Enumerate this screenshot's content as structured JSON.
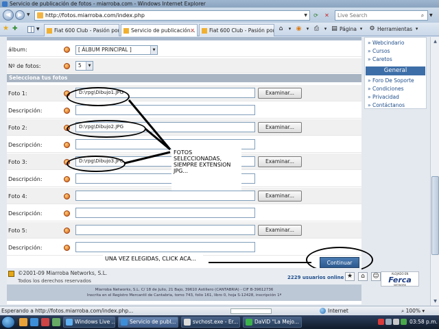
{
  "window": {
    "title": "Servicio de publicación de fotos - miarroba.com - Windows Internet Explorer"
  },
  "address": {
    "url": "http://fotos.miarroba.com/index.php",
    "search_placeholder": "Live Search"
  },
  "tabs": [
    {
      "label": "Fiat 600 Club - Pasión por ..."
    },
    {
      "label": "Servicio de publicación..."
    },
    {
      "label": "Fiat 600 Club - Pasión por ..."
    }
  ],
  "toolbar": {
    "page_label": "Página",
    "tools_label": "Herramientas"
  },
  "form": {
    "album_label": "álbum:",
    "album_value": "[ ÁLBUM PRINCIPAL ]",
    "count_label": "Nº de fotos:",
    "count_value": "5",
    "section_title": "Selecciona tus fotos",
    "browse_label": "Examinar...",
    "description_label": "Descripción:",
    "photos": [
      {
        "label": "Foto 1:",
        "value": "D:\\rpg\\Dibujo1.JPG"
      },
      {
        "label": "Foto 2:",
        "value": "D:\\rpg\\Dibujo2.JPG"
      },
      {
        "label": "Foto 3:",
        "value": "D:\\rpg\\Dibujo3.JPG"
      },
      {
        "label": "Foto 4:",
        "value": ""
      },
      {
        "label": "Foto 5:",
        "value": ""
      }
    ],
    "continue_label": "Continuar"
  },
  "annotations": {
    "photos_note": "FOTOS SELECCIONADAS, SIEMPRE EXTENSION JPG...",
    "continue_note": "UNA VEZ ELEGIDAS, CLICK ACA..."
  },
  "footer": {
    "copyright": "©2001-09 Miarroba Networks, S.L.",
    "rights": "Todos los derechos reservados",
    "users": "2229 usuarios online",
    "legal_line1": "Miarroba Networks, S.L. C/ 18 de Julio, 21 Bajo, 39610 Astillero (CANTABRIA) - CIF B-39612736",
    "legal_line2": "Inscrita en el Registro Mercantil de Cantabria, tomo 743, folio 161, libro 0, hoja S-12428, inscripción 1ª",
    "ferca_top": "ALOJADO EN",
    "ferca_brand": "Ferca",
    "ferca_bottom": "NETWORK"
  },
  "sidebar": {
    "links_top": [
      "Webcindario",
      "Cursos",
      "Caretos"
    ],
    "header": "General",
    "links_bottom": [
      "Foro De Soporte",
      "Condiciones",
      "Privacidad",
      "Contáctanos"
    ]
  },
  "status": {
    "text": "Esperando a http://fotos.miarroba.com/index.php...",
    "zone": "Internet",
    "zoom": "100%"
  },
  "taskbar": {
    "tasks": [
      "Windows Live ...",
      "Servicio de publ...",
      "svchost.exe - Er...",
      "DaViD \"La Mejo..."
    ],
    "clock": "03:58 p.m."
  },
  "colors": {
    "accent": "#2d5a8f",
    "sidebar_header": "#3d6ea8",
    "section_header": "#a8b4c2"
  }
}
